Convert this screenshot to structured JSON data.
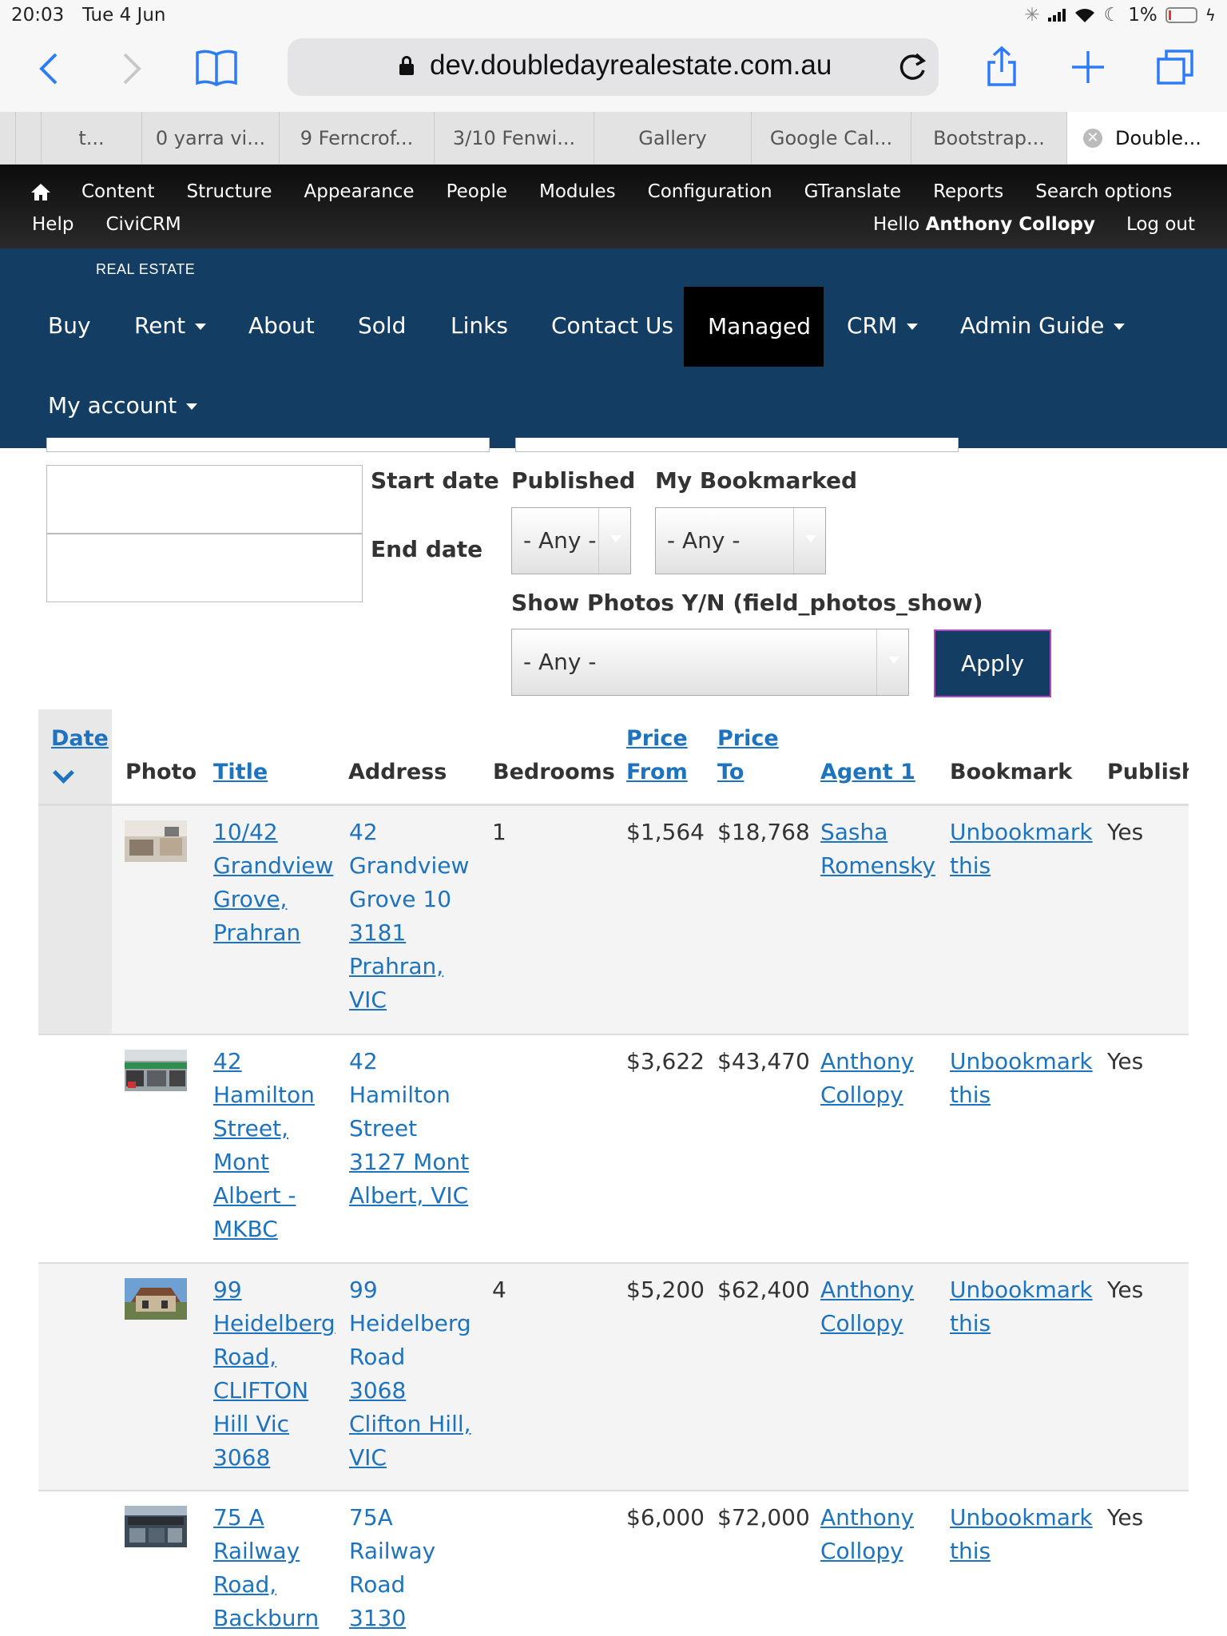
{
  "status_bar": {
    "time": "20:03",
    "date": "Tue 4 Jun",
    "battery": "1%"
  },
  "browser": {
    "url": "dev.doubledayrealestate.com.au",
    "tabs": [
      "t...",
      "0 yarra vi...",
      "9 Ferncrof...",
      "3/10 Fenwi...",
      "Gallery",
      "Google Cal...",
      "Bootstrap...",
      "Double..."
    ],
    "icons": {
      "back": "back-chevron-icon",
      "forward": "forward-chevron-icon",
      "bookmarks": "book-icon",
      "reload": "reload-icon",
      "share": "share-icon",
      "new_tab": "plus-icon",
      "tabs": "tabs-icon"
    }
  },
  "admin_menu": {
    "items": [
      "Content",
      "Structure",
      "Appearance",
      "People",
      "Modules",
      "Configuration",
      "GTranslate",
      "Reports",
      "Search options"
    ],
    "row2": [
      "Help",
      "CiviCRM"
    ],
    "hello_prefix": "Hello",
    "user": "Anthony Collopy",
    "logout": "Log out"
  },
  "site": {
    "logo_sub": "REAL ESTATE",
    "nav": [
      "Buy",
      "Rent",
      "About",
      "Sold",
      "Links",
      "Contact Us",
      "Managed",
      "CRM",
      "Admin Guide",
      "My account"
    ],
    "active_nav": "Managed",
    "colors": {
      "header": "#143d63",
      "link": "#1e73be",
      "apply_border": "#b049c4"
    }
  },
  "filters": {
    "start_date_label": "Start date",
    "end_date_label": "End date",
    "published_label": "Published",
    "published_value": "- Any -",
    "bookmarked_label": "My Bookmarked",
    "bookmarked_value": "- Any -",
    "photos_label": "Show Photos Y/N (field_photos_show)",
    "photos_value": "- Any -",
    "apply_label": "Apply"
  },
  "table": {
    "headers": {
      "date": "Date",
      "photo": "Photo",
      "title": "Title",
      "address": "Address",
      "bedrooms": "Bedrooms",
      "price_from_1": "Price",
      "price_from_2": "From",
      "price_to_1": "Price",
      "price_to_2": "To",
      "agent": "Agent 1",
      "bookmark": "Bookmark",
      "published": "Published"
    },
    "rows": [
      {
        "title": [
          "10/42",
          "Grandview",
          "Grove,",
          "Prahran"
        ],
        "address": [
          "42",
          "Grandview",
          "Grove 10",
          "3181",
          "Prahran,",
          "VIC"
        ],
        "bedrooms": "1",
        "price_from": "$1,564",
        "price_to": "$18,768",
        "agent": [
          "Sasha",
          "Romensky"
        ],
        "bookmark": [
          "Unbookmark",
          "this"
        ],
        "published": "Yes"
      },
      {
        "title": [
          "42",
          "Hamilton",
          "Street,",
          "Mont",
          "Albert -",
          "MKBC"
        ],
        "address": [
          "42",
          "Hamilton",
          "Street",
          "3127 Mont",
          "Albert, VIC"
        ],
        "bedrooms": "",
        "price_from": "$3,622",
        "price_to": "$43,470",
        "agent": [
          "Anthony",
          "Collopy"
        ],
        "bookmark": [
          "Unbookmark",
          "this"
        ],
        "published": "Yes"
      },
      {
        "title": [
          "99",
          "Heidelberg",
          "Road,",
          "CLIFTON",
          "Hill Vic",
          "3068"
        ],
        "address": [
          "99",
          "Heidelberg",
          "Road",
          "3068",
          "Clifton Hill,",
          "VIC"
        ],
        "bedrooms": "4",
        "price_from": "$5,200",
        "price_to": "$62,400",
        "agent": [
          "Anthony",
          "Collopy"
        ],
        "bookmark": [
          "Unbookmark",
          "this"
        ],
        "published": "Yes"
      },
      {
        "title": [
          "75 A",
          "Railway",
          "Road,",
          "Backburn"
        ],
        "address": [
          "75A",
          "Railway",
          "Road",
          "3130"
        ],
        "bedrooms": "",
        "price_from": "$6,000",
        "price_to": "$72,000",
        "agent": [
          "Anthony",
          "Collopy"
        ],
        "bookmark": [
          "Unbookmark",
          "this"
        ],
        "published": "Yes"
      }
    ]
  }
}
